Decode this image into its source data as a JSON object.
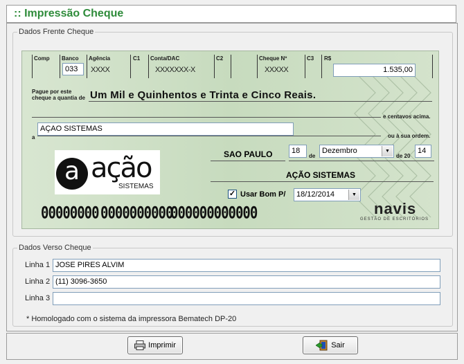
{
  "window": {
    "title": ":: Impressão Cheque"
  },
  "frente": {
    "legend": "Dados Frente Cheque",
    "labels": {
      "comp": "Comp",
      "banco": "Banco",
      "agencia": "Agência",
      "c1": "C1",
      "conta": "Conta/DAC",
      "c2": "C2",
      "cheque_no": "Cheque Nº",
      "c3": "C3",
      "rs": "R$"
    },
    "banco_value": "033",
    "agencia_mask": "XXXX",
    "conta_mask": "XXXXXXX-X",
    "cheque_mask": "XXXXX",
    "valor": "1.535,00",
    "pague_label_1": "Pague por este",
    "pague_label_2": "cheque a quantia de",
    "extenso": "Um Mil e Quinhentos e Trinta e Cinco Reais.",
    "centavos_label": "e centavos acima.",
    "a_label": "a",
    "favorecido": "AÇAO SISTEMAS",
    "ordem_label": "ou à sua ordem.",
    "cidade": "SAO PAULO",
    "dia": "18",
    "de_label_1": "de",
    "mes": "Dezembro",
    "de20_label": "de 20",
    "ano": "14",
    "emitente": "AÇÃO SISTEMAS",
    "bom_para_label": "Usar Bom P/",
    "bom_para_checked": true,
    "bom_para_data": "18/12/2014",
    "micr": [
      "00000000",
      "0000000000",
      "000000000000"
    ],
    "logo_acao": {
      "letter": "a",
      "word": "ação",
      "sub": "SISTEMAS"
    },
    "logo_navis": {
      "word": "navis",
      "sub": "GESTÃO DE ESCRITÓRIOS"
    }
  },
  "verso": {
    "legend": "Dados Verso Cheque",
    "linhas": [
      {
        "label": "Linha 1",
        "value": "JOSE PIRES ALVIM"
      },
      {
        "label": "Linha 2",
        "value": "(11) 3096-3650"
      },
      {
        "label": "Linha 3",
        "value": ""
      }
    ],
    "nota": "* Homologado com o sistema da impressora Bematech DP-20"
  },
  "buttons": {
    "imprimir": "Imprimir",
    "sair": "Sair"
  },
  "icons": {
    "printer": "printer-icon",
    "exit": "exit-door-icon",
    "dropdown": "chevron-down-icon",
    "check": "checkmark-icon"
  }
}
